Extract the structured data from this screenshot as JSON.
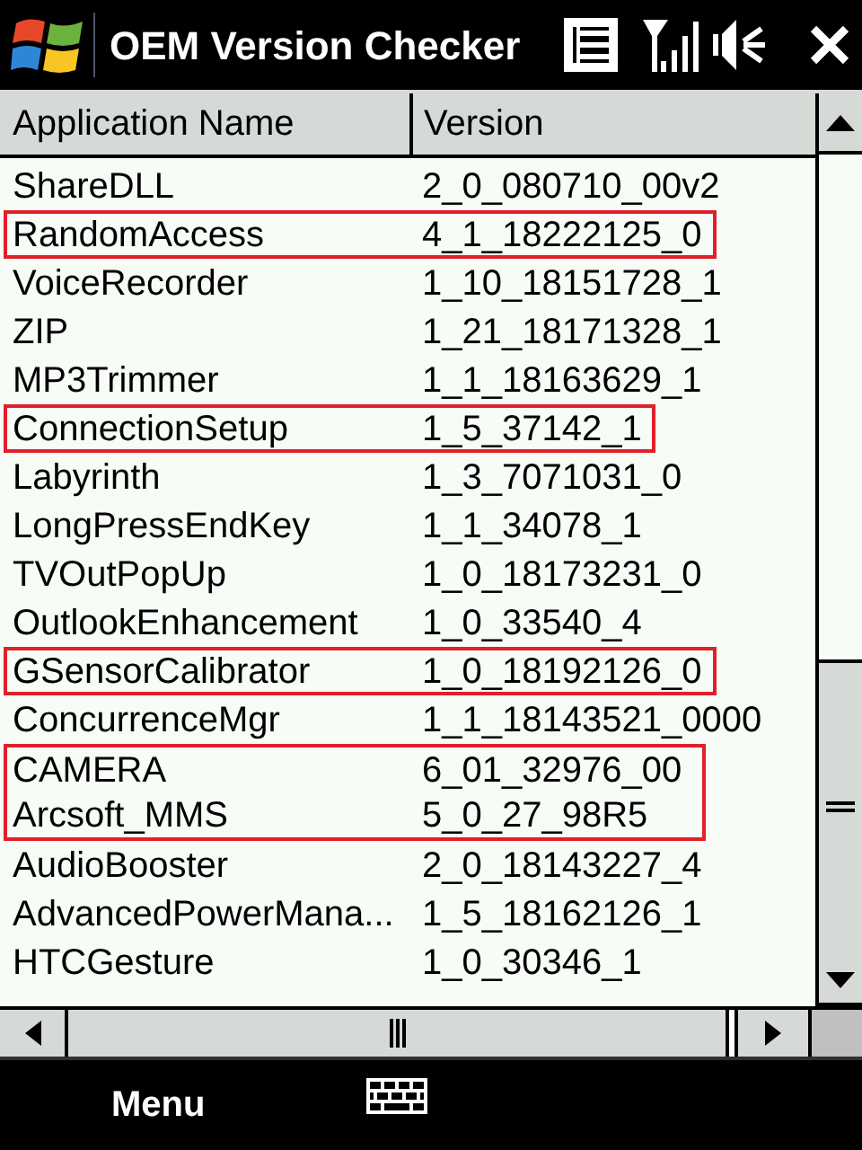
{
  "window": {
    "title": "OEM Version Checker"
  },
  "table": {
    "columns": [
      "Application Name",
      "Version"
    ],
    "rows": [
      {
        "name": "ShareDLL",
        "version": "2_0_080710_00v2",
        "marked": false
      },
      {
        "name": "RandomAccess",
        "version": "4_1_18222125_0",
        "marked": true
      },
      {
        "name": "VoiceRecorder",
        "version": "1_10_18151728_1",
        "marked": false
      },
      {
        "name": "ZIP",
        "version": "1_21_18171328_1",
        "marked": false
      },
      {
        "name": "MP3Trimmer",
        "version": "1_1_18163629_1",
        "marked": false
      },
      {
        "name": "ConnectionSetup",
        "version": "1_5_37142_1",
        "marked": true
      },
      {
        "name": "Labyrinth",
        "version": "1_3_7071031_0",
        "marked": false
      },
      {
        "name": "LongPressEndKey",
        "version": "1_1_34078_1",
        "marked": false
      },
      {
        "name": "TVOutPopUp",
        "version": "1_0_18173231_0",
        "marked": false
      },
      {
        "name": "OutlookEnhancement",
        "version": "1_0_33540_4",
        "marked": false
      },
      {
        "name": "GSensorCalibrator",
        "version": "1_0_18192126_0",
        "marked": true
      },
      {
        "name": "ConcurrenceMgr",
        "version": "1_1_18143521_0000",
        "marked": false
      },
      {
        "name": "CAMERA",
        "version": "6_01_32976_00",
        "marked": true
      },
      {
        "name": "Arcsoft_MMS",
        "version": "5_0_27_98R5",
        "marked": true
      },
      {
        "name": "AudioBooster",
        "version": "2_0_18143227_4",
        "marked": false
      },
      {
        "name": "AdvancedPowerMana...",
        "version": "1_5_18162126_1",
        "marked": false
      },
      {
        "name": "HTCGesture",
        "version": "1_0_30346_1",
        "marked": false
      }
    ]
  },
  "softkeys": {
    "left": "Menu"
  }
}
